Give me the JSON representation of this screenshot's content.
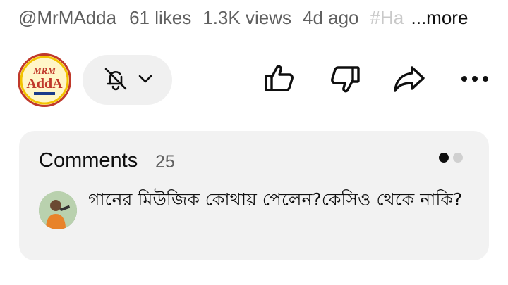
{
  "meta": {
    "handle": "@MrMAdda",
    "likes": "61 likes",
    "views": "1.3K views",
    "age": "4d ago",
    "hashtag": "#Ha",
    "more_label": "...more"
  },
  "channel": {
    "logo_text_top": "MRM",
    "logo_text_main": "AddA",
    "logo_colors": {
      "ring": "#c0392b",
      "fill": "#fff6c8",
      "text": "#c0392b"
    }
  },
  "actions": {
    "bell_icon": "bell-off-icon",
    "like_icon": "thumbs-up-icon",
    "dislike_icon": "thumbs-down-icon",
    "share_icon": "share-icon",
    "more_icon": "more-horizontal-icon"
  },
  "comments": {
    "title": "Comments",
    "count": "25",
    "pager_active_index": 0,
    "pager_total": 2,
    "top_comment": {
      "text": "গানের মিউজিক কোথায় পেলেন?কেসিও থেকে নাকি?"
    }
  },
  "colors": {
    "background": "#ffffff",
    "card": "#f2f2f2",
    "pill": "#f0f0f0",
    "secondary_text": "#606060",
    "primary_text": "#0f0f0f"
  }
}
